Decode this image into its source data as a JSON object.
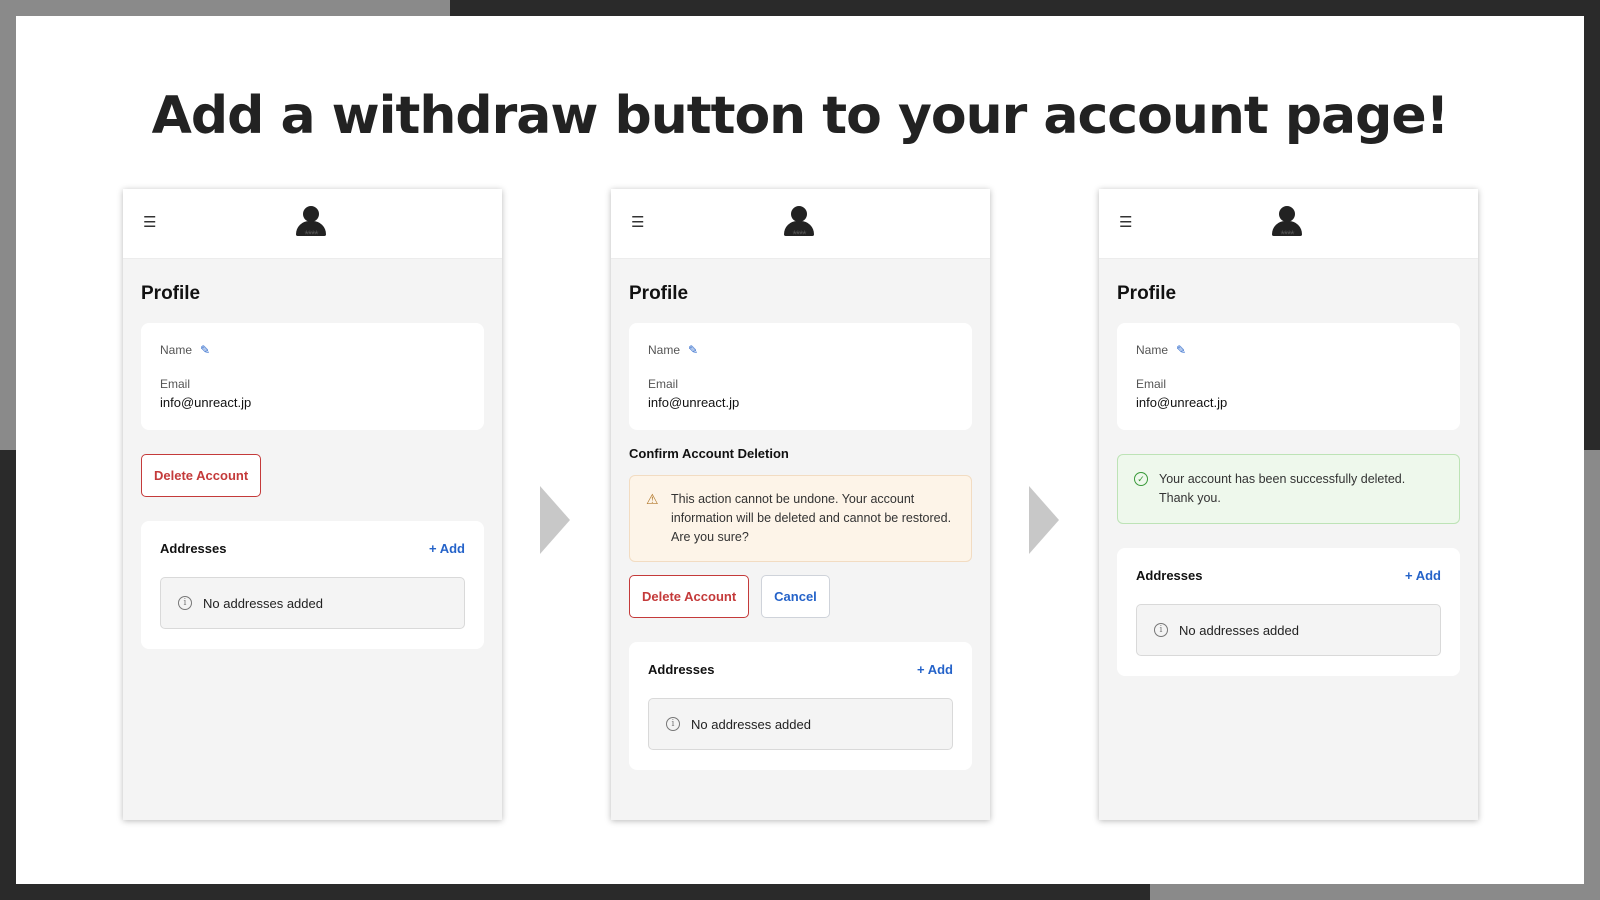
{
  "headline": "Add a withdraw button to your account page!",
  "icons": {
    "menu": "☰",
    "pencil": "✎",
    "warning": "⚠",
    "check": "✓",
    "info": "i",
    "logo_stars": "****"
  },
  "colors": {
    "accent": "#2563c9",
    "danger": "#c43a3a",
    "warning_bg": "#fdf4e8",
    "success_bg": "#eef8ec"
  },
  "profile": {
    "title": "Profile",
    "name_label": "Name",
    "email_label": "Email",
    "email_value": "info@unreact.jp"
  },
  "delete_button": "Delete Account",
  "confirm": {
    "title": "Confirm Account Deletion",
    "message": "This action cannot be undone. Your account information will be deleted and cannot be restored. Are you sure?",
    "delete_label": "Delete Account",
    "cancel_label": "Cancel"
  },
  "success_message": "Your account has been successfully deleted. Thank you.",
  "addresses": {
    "title": "Addresses",
    "add_label": "+ Add",
    "empty_text": "No addresses added"
  }
}
